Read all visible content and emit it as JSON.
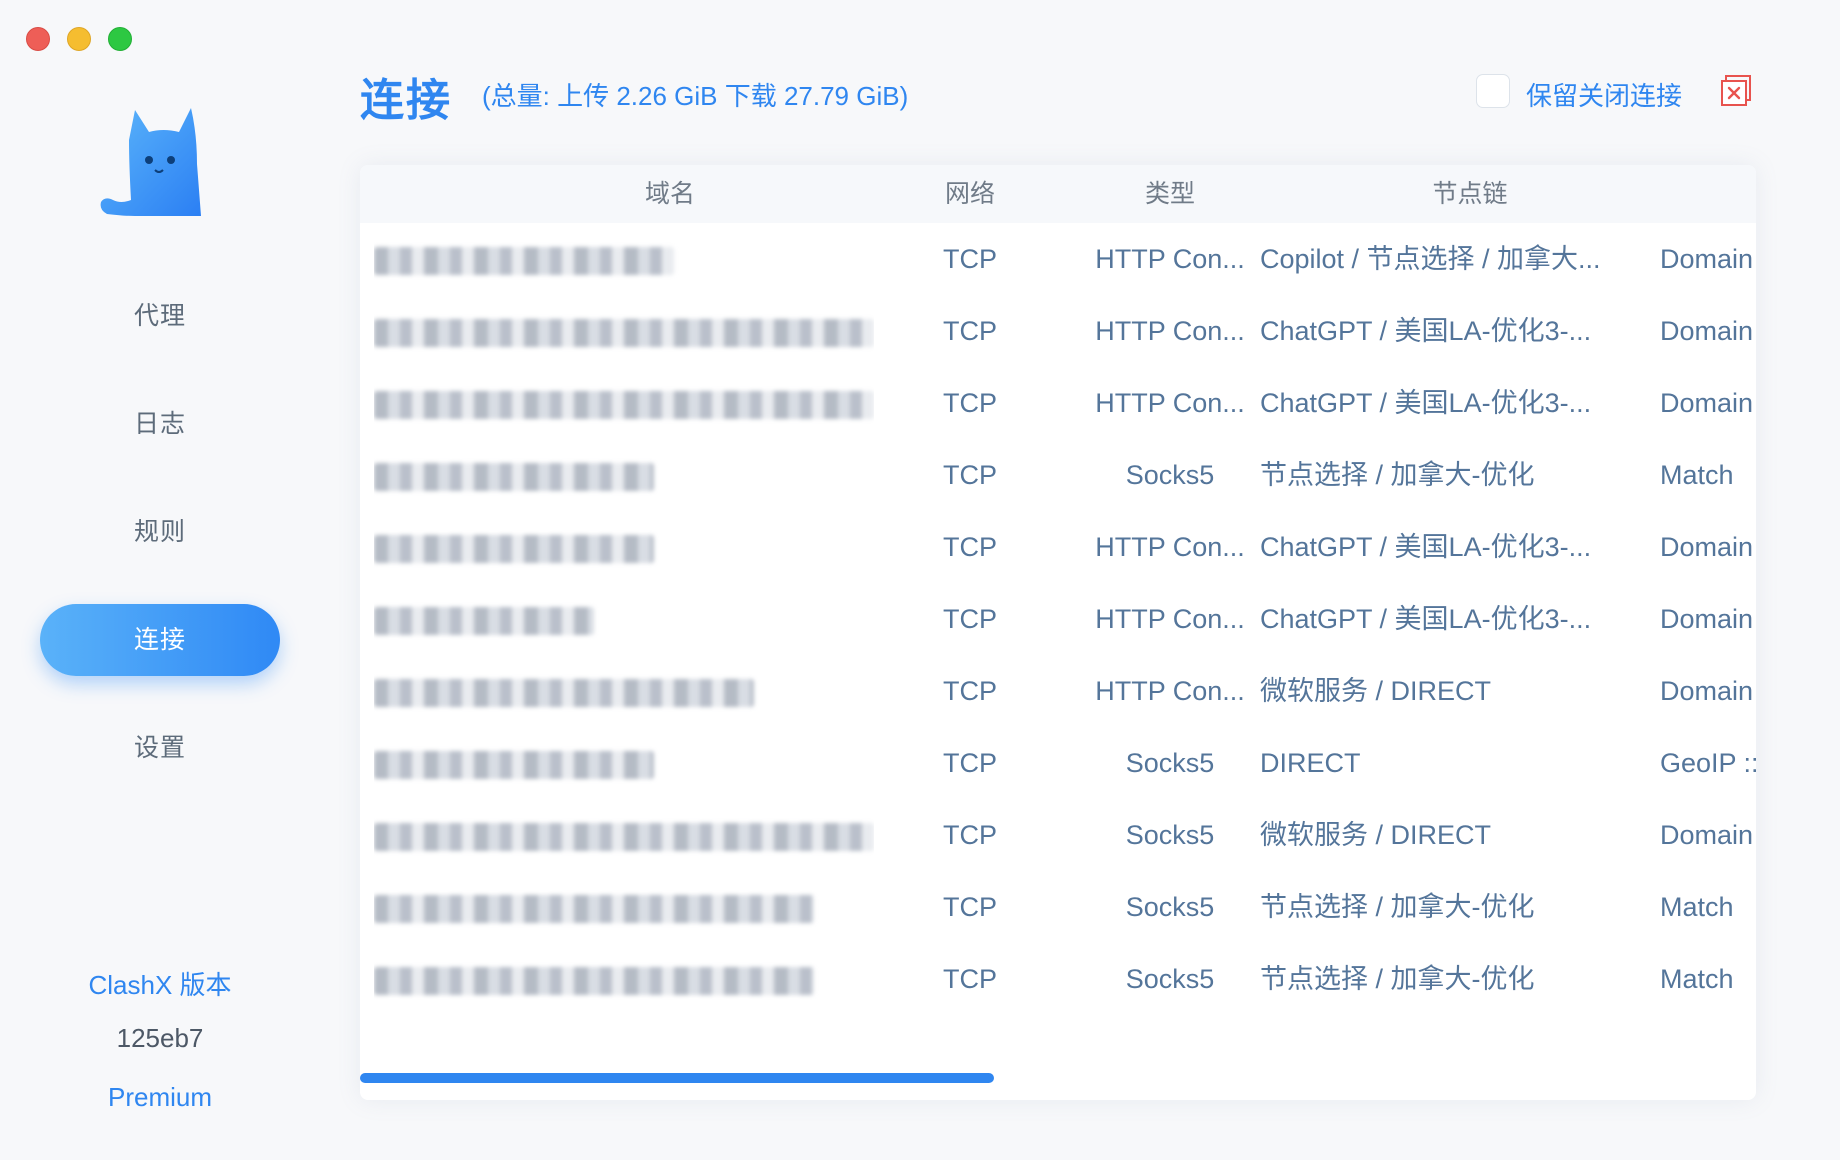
{
  "sidebar": {
    "nav": [
      {
        "label": "代理",
        "active": false
      },
      {
        "label": "日志",
        "active": false
      },
      {
        "label": "规则",
        "active": false
      },
      {
        "label": "连接",
        "active": true
      },
      {
        "label": "设置",
        "active": false
      }
    ],
    "version_title": "ClashX 版本",
    "version_hash": "125eb7",
    "edition": "Premium"
  },
  "header": {
    "title": "连接",
    "summary": "(总量: 上传 2.26 GiB 下载 27.79 GiB)",
    "keep_closed_label": "保留关闭连接",
    "keep_closed_checked": false
  },
  "table": {
    "headers": {
      "host": "域名",
      "network": "网络",
      "type": "类型",
      "chain": "节点链"
    },
    "rows": [
      {
        "host_tail": "",
        "network": "TCP",
        "type": "HTTP Con...",
        "chain": "Copilot / 节点选择 / 加拿大...",
        "rule": "Domain"
      },
      {
        "host_tail": "",
        "network": "TCP",
        "type": "HTTP Con...",
        "chain": "ChatGPT / 美国LA-优化3-...",
        "rule": "Domain"
      },
      {
        "host_tail": "",
        "network": "TCP",
        "type": "HTTP Con...",
        "chain": "ChatGPT / 美国LA-优化3-...",
        "rule": "Domain"
      },
      {
        "host_tail": "",
        "network": "TCP",
        "type": "Socks5",
        "chain": "节点选择 / 加拿大-优化",
        "rule": "Match"
      },
      {
        "host_tail": "",
        "network": "TCP",
        "type": "HTTP Con...",
        "chain": "ChatGPT / 美国LA-优化3-...",
        "rule": "Domain"
      },
      {
        "host_tail": "",
        "network": "TCP",
        "type": "HTTP Con...",
        "chain": "ChatGPT / 美国LA-优化3-...",
        "rule": "Domain"
      },
      {
        "host_tail": "",
        "network": "TCP",
        "type": "HTTP Con...",
        "chain": "微软服务 / DIRECT",
        "rule": "Domain"
      },
      {
        "host_tail": "",
        "network": "TCP",
        "type": "Socks5",
        "chain": "DIRECT",
        "rule": "GeoIP ::"
      },
      {
        "host_tail": "..",
        "network": "TCP",
        "type": "Socks5",
        "chain": "微软服务 / DIRECT",
        "rule": "Domain"
      },
      {
        "host_tail": "",
        "network": "TCP",
        "type": "Socks5",
        "chain": "节点选择 / 加拿大-优化",
        "rule": "Match"
      },
      {
        "host_tail": "",
        "network": "TCP",
        "type": "Socks5",
        "chain": "节点选择 / 加拿大-优化",
        "rule": "Match"
      }
    ]
  },
  "colors": {
    "accent": "#2f86f0",
    "text": "#54759a",
    "close_red": "#e8534e"
  }
}
